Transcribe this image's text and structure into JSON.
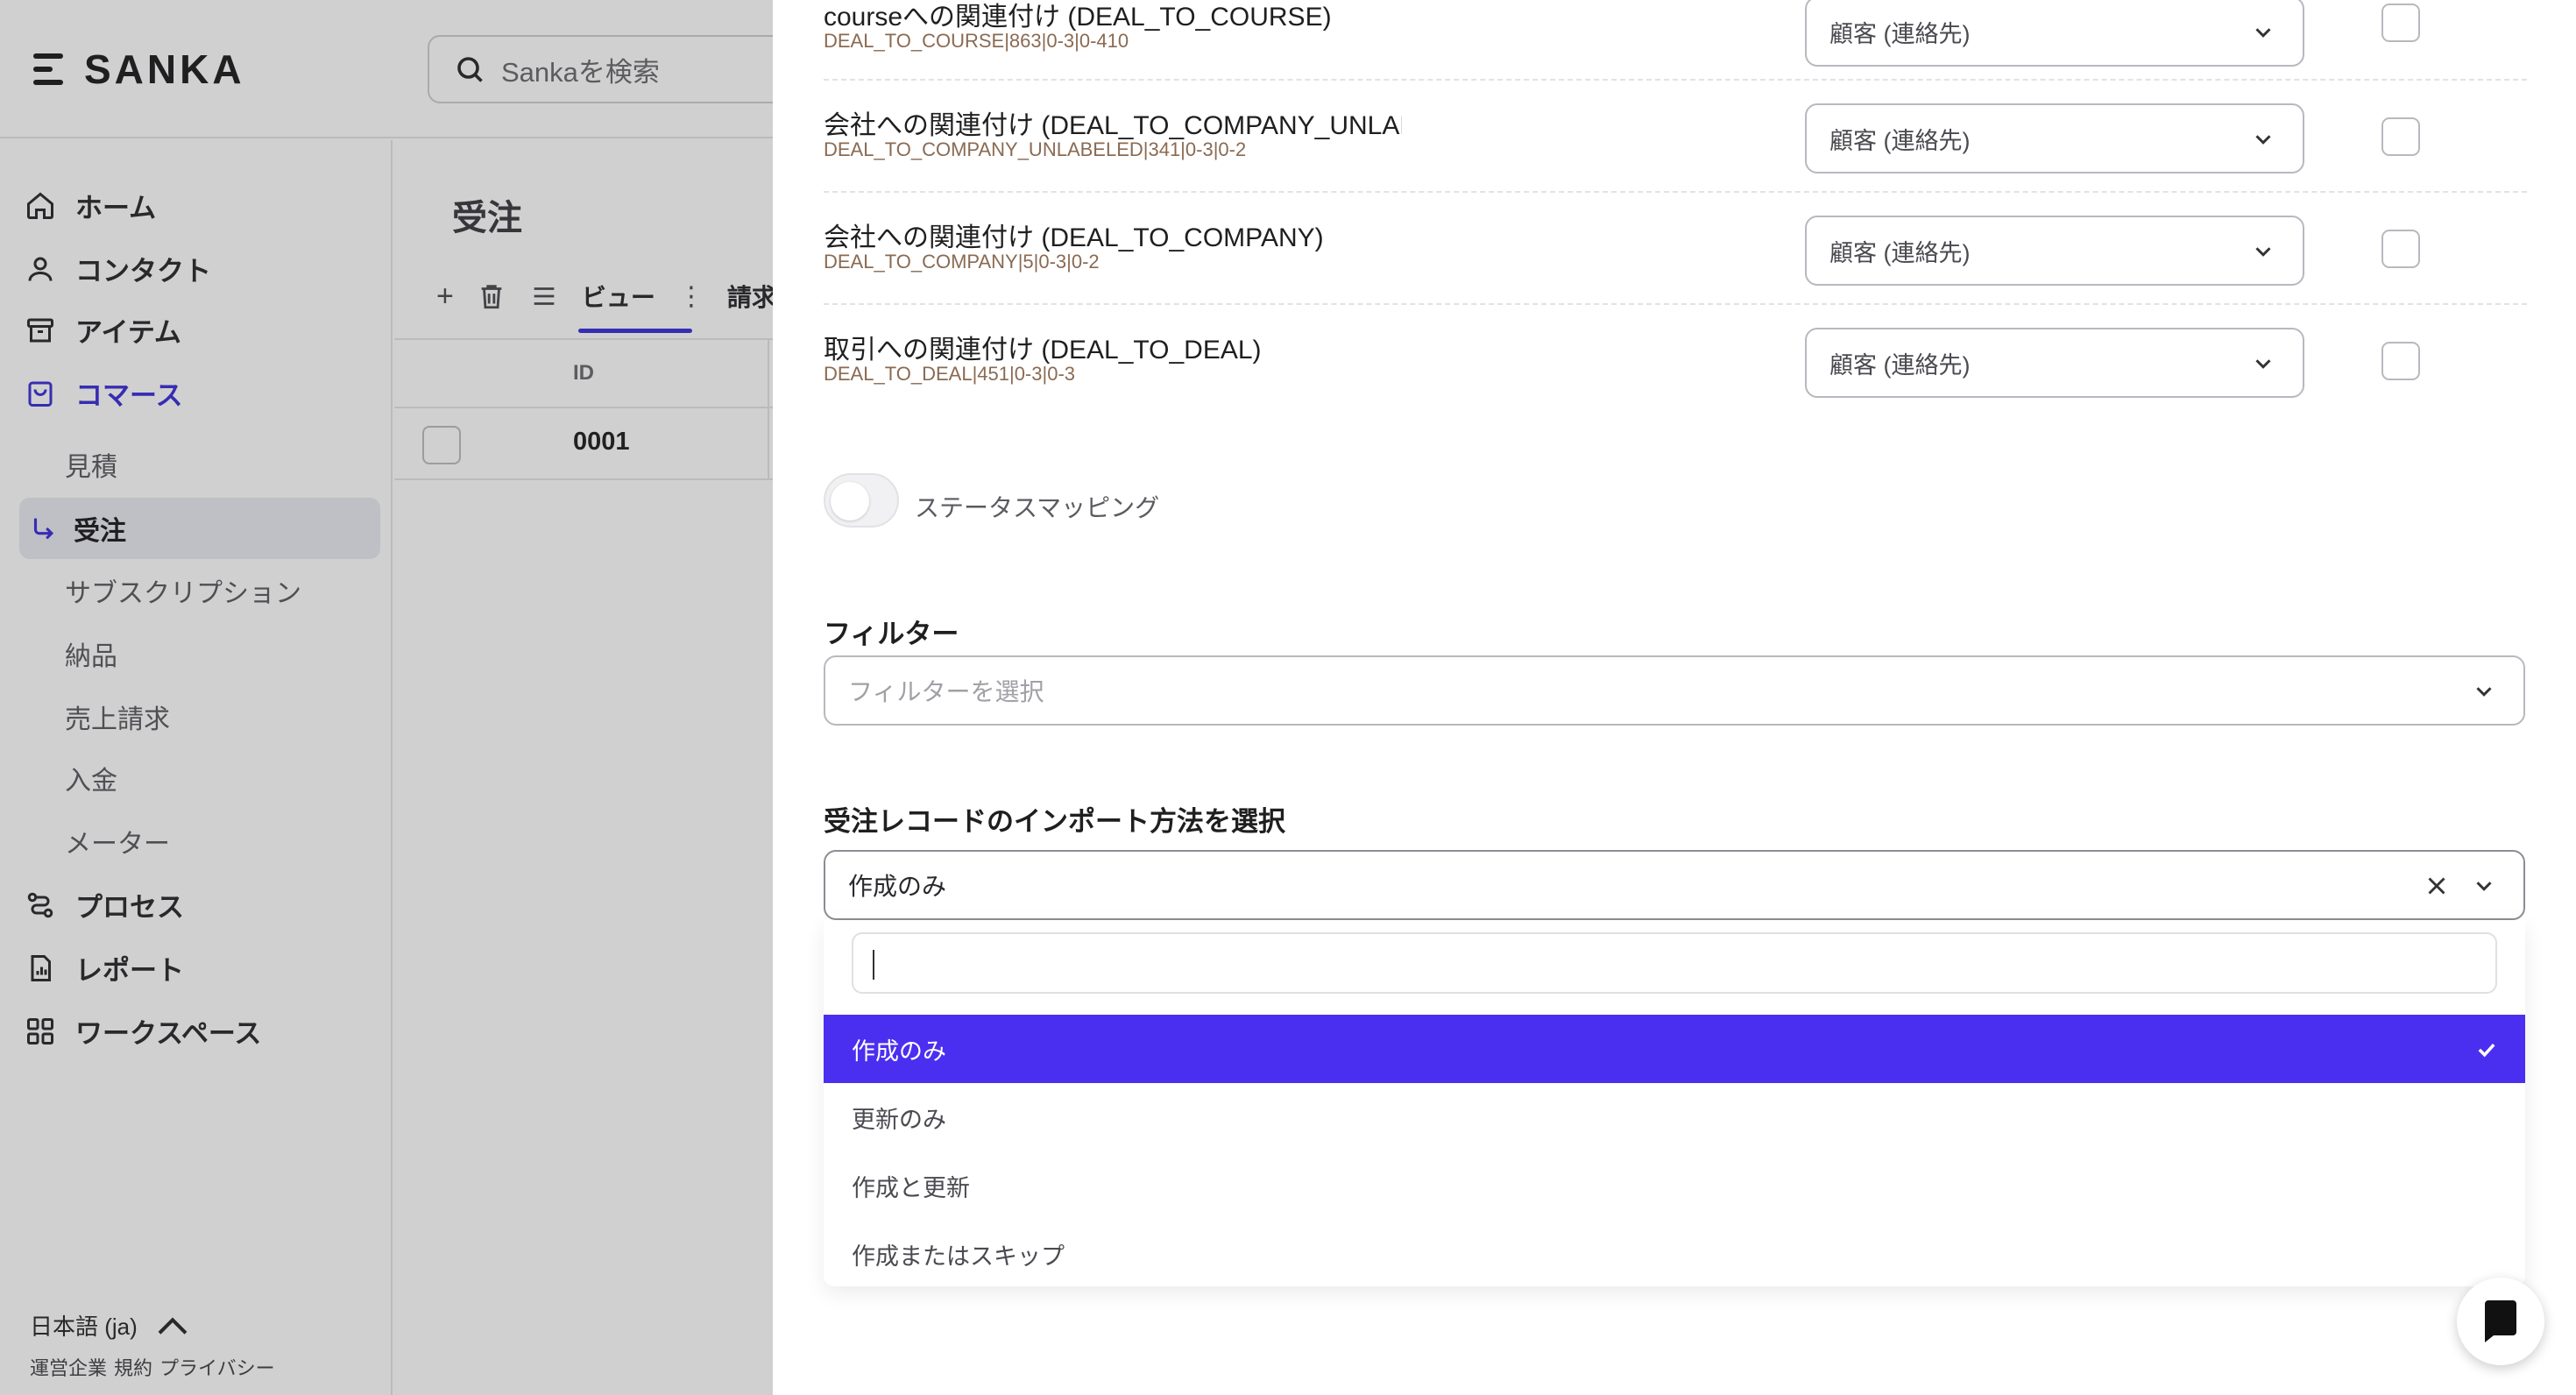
{
  "app": {
    "logo": "SANKA",
    "search_placeholder": "Sankaを検索"
  },
  "sidebar": {
    "items": [
      {
        "label": "ホーム",
        "icon": "home-icon"
      },
      {
        "label": "コンタクト",
        "icon": "user-icon"
      },
      {
        "label": "アイテム",
        "icon": "archive-icon"
      },
      {
        "label": "コマース",
        "icon": "shopping-bag-icon"
      }
    ],
    "commerce_sub": [
      "見積",
      "受注",
      "サブスクリプション",
      "納品",
      "売上請求",
      "入金",
      "メーター"
    ],
    "active_sub": "受注",
    "items_bottom": [
      {
        "label": "プロセス",
        "icon": "process-icon"
      },
      {
        "label": "レポート",
        "icon": "report-icon"
      },
      {
        "label": "ワークスペース",
        "icon": "grid-icon"
      }
    ],
    "language": "日本語 (ja)",
    "footer_links": [
      "運営企業",
      "規約",
      "プライバシー"
    ]
  },
  "main": {
    "title": "受注",
    "toolbar": {
      "view_tab": "ビュー",
      "invoice_tab": "請求"
    },
    "table": {
      "id_header": "ID",
      "rows": [
        {
          "id": "0001"
        }
      ]
    }
  },
  "panel": {
    "mappings": [
      {
        "label": "courseへの関連付け (DEAL_TO_COURSE)",
        "code": "DEAL_TO_COURSE|863|0-3|0-410",
        "select": "顧客 (連絡先)"
      },
      {
        "label": "会社への関連付け (DEAL_TO_COMPANY_UNLABELED)",
        "code": "DEAL_TO_COMPANY_UNLABELED|341|0-3|0-2",
        "select": "顧客 (連絡先)"
      },
      {
        "label": "会社への関連付け (DEAL_TO_COMPANY)",
        "code": "DEAL_TO_COMPANY|5|0-3|0-2",
        "select": "顧客 (連絡先)"
      },
      {
        "label": "取引への関連付け (DEAL_TO_DEAL)",
        "code": "DEAL_TO_DEAL|451|0-3|0-3",
        "select": "顧客 (連絡先)"
      }
    ],
    "status_mapping_label": "ステータスマッピング",
    "status_mapping_on": false,
    "filter_title": "フィルター",
    "filter_placeholder": "フィルターを選択",
    "import_title": "受注レコードのインポート方法を選択",
    "import_selected": "作成のみ",
    "import_options": [
      "作成のみ",
      "更新のみ",
      "作成と更新",
      "作成またはスキップ"
    ],
    "accent": "#4a2ff0"
  }
}
